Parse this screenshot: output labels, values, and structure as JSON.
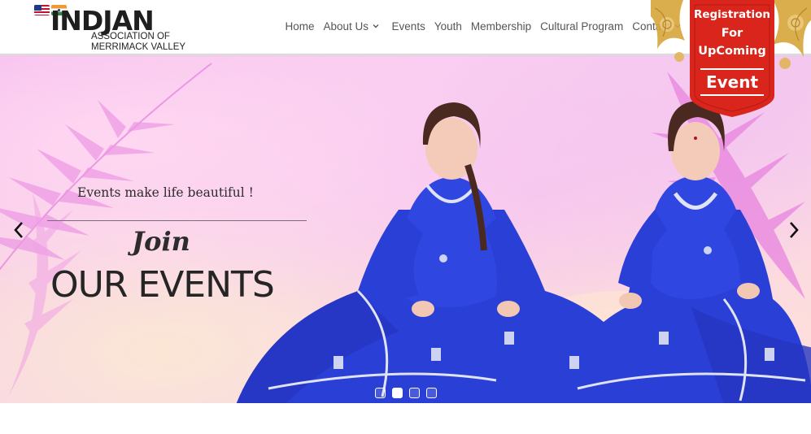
{
  "logo": {
    "word": "INDJAN",
    "line1": "ASSOCIATION OF",
    "line2": "MERRIMACK VALLEY"
  },
  "nav": {
    "items": [
      {
        "label": "Home"
      },
      {
        "label": "About Us",
        "has_dropdown": true
      },
      {
        "label": "Events"
      },
      {
        "label": "Youth"
      },
      {
        "label": "Membership"
      },
      {
        "label": "Cultural Program"
      },
      {
        "label": "Contact",
        "has_dropdown": true
      }
    ]
  },
  "ribbon": {
    "line1": "Registration",
    "line2": "For",
    "line3": "UpComing",
    "line4": "Event",
    "color": "#d9251c",
    "accent": "#d6a53a"
  },
  "hero": {
    "tagline": "Events make life beautiful !",
    "join": "Join",
    "headline": "OUR EVENTS",
    "slides": {
      "count": 4,
      "active_index": 1
    }
  },
  "colors": {
    "nav_text": "#555555",
    "hero_pink": "#f4b8ef",
    "dress_blue": "#2a3fd6"
  }
}
